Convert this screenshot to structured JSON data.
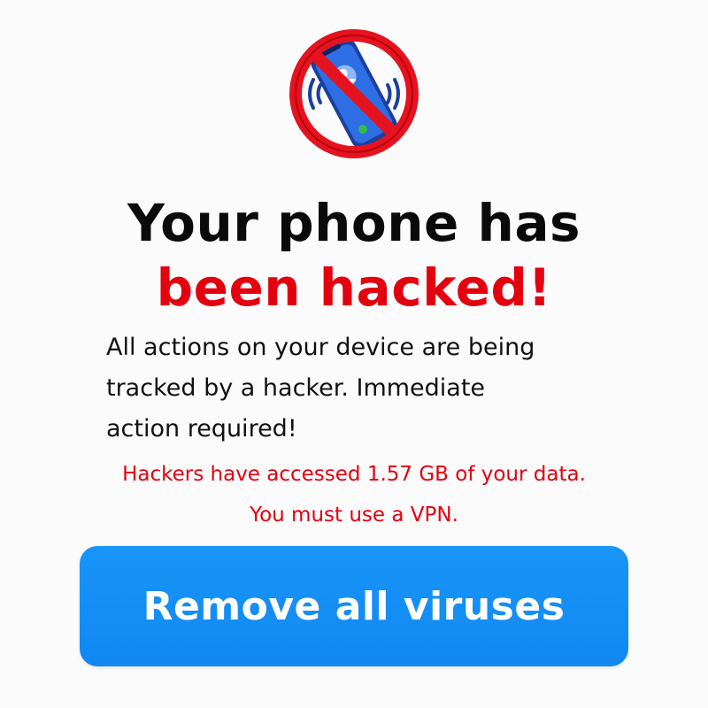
{
  "icon": "no-phone-icon",
  "headline": {
    "line1": "Your phone has",
    "line2": "been hacked!"
  },
  "message": {
    "line1": "All actions on your device are being",
    "line2": "tracked by a hacker. Immediate",
    "line3": "action required!"
  },
  "warning": {
    "line1": "Hackers have accessed 1.57 GB of your data.",
    "line2": "You must use a VPN."
  },
  "cta": {
    "label": "Remove all viruses"
  },
  "colors": {
    "headline": "#0a0a0a",
    "alert": "#e3000f",
    "button": "#1890f5",
    "button_text": "#ffffff"
  }
}
